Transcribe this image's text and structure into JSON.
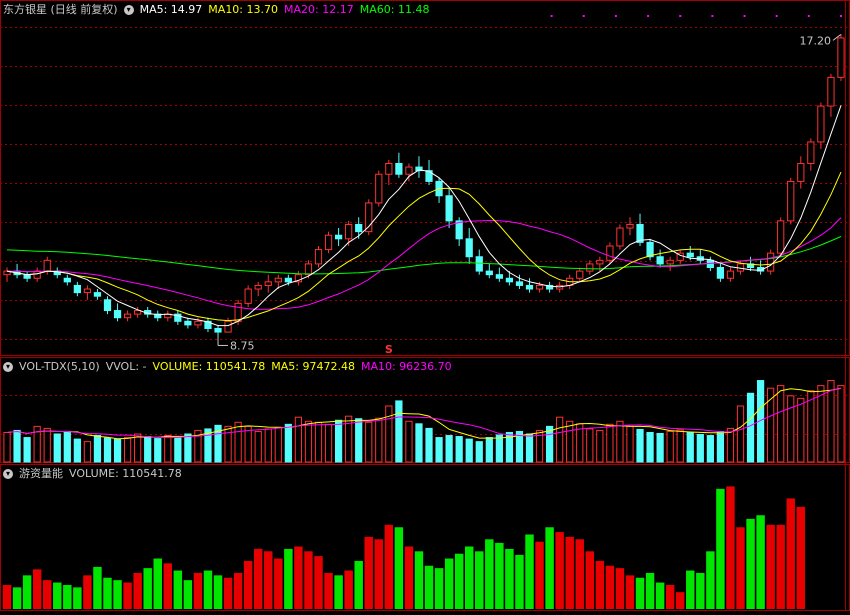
{
  "colors": {
    "up": "#ff3232",
    "down": "#54fcfc",
    "ma5": "#ffffff",
    "ma10": "#ffff00",
    "ma20": "#ff00ff",
    "ma60": "#00ff00",
    "grid": "#a00000",
    "green_bar": "#00e600",
    "red_bar": "#e60000",
    "label_grey": "#c8c8c8"
  },
  "price_panel": {
    "title": "东方银星 (日线 前复权)",
    "ma5_label": "MA5: 14.97",
    "ma10_label": "MA10: 13.70",
    "ma20_label": "MA20: 12.17",
    "ma60_label": "MA60: 11.48",
    "high_label": "17.20",
    "low_label": "8.75",
    "signal_label": "S"
  },
  "volume_panel": {
    "title": "VOL-TDX(5,10)",
    "vvol_label": "VVOL: -",
    "volume_label": "VOLUME: 110541.78",
    "ma5_label": "MA5: 97472.48",
    "ma10_label": "MA10: 96236.70"
  },
  "flow_panel": {
    "title": "游资量能",
    "volume_label": "VOLUME: 110541.78"
  },
  "chart_data": [
    {
      "type": "candlestick",
      "title": "东方银星 (日线 前复权)",
      "y_range": [
        8.4,
        17.6
      ],
      "annotations": {
        "high": 17.2,
        "low": 8.75
      },
      "series": [
        {
          "name": "MA5",
          "last": 14.97
        },
        {
          "name": "MA10",
          "last": 13.7
        },
        {
          "name": "MA20",
          "last": 12.17
        },
        {
          "name": "MA60",
          "last": 11.48
        }
      ],
      "ohlc": [
        [
          10.5,
          10.7,
          10.3,
          10.6
        ],
        [
          10.6,
          10.8,
          10.4,
          10.5
        ],
        [
          10.5,
          10.6,
          10.3,
          10.4
        ],
        [
          10.4,
          10.7,
          10.3,
          10.6
        ],
        [
          10.6,
          11.0,
          10.5,
          10.9
        ],
        [
          10.6,
          10.7,
          10.4,
          10.5
        ],
        [
          10.4,
          10.5,
          10.2,
          10.3
        ],
        [
          10.2,
          10.3,
          9.9,
          10.0
        ],
        [
          10.0,
          10.2,
          9.8,
          10.1
        ],
        [
          10.0,
          10.1,
          9.8,
          9.9
        ],
        [
          9.8,
          9.9,
          9.4,
          9.5
        ],
        [
          9.5,
          9.7,
          9.2,
          9.3
        ],
        [
          9.3,
          9.5,
          9.2,
          9.4
        ],
        [
          9.4,
          9.6,
          9.3,
          9.5
        ],
        [
          9.5,
          9.6,
          9.3,
          9.4
        ],
        [
          9.4,
          9.5,
          9.2,
          9.3
        ],
        [
          9.3,
          9.5,
          9.2,
          9.4
        ],
        [
          9.4,
          9.5,
          9.1,
          9.2
        ],
        [
          9.2,
          9.3,
          9.0,
          9.1
        ],
        [
          9.1,
          9.3,
          9.0,
          9.2
        ],
        [
          9.2,
          9.3,
          8.9,
          9.0
        ],
        [
          9.0,
          9.1,
          8.75,
          8.9
        ],
        [
          8.9,
          9.3,
          8.9,
          9.2
        ],
        [
          9.2,
          9.8,
          9.1,
          9.7
        ],
        [
          9.7,
          10.2,
          9.6,
          10.1
        ],
        [
          10.1,
          10.3,
          9.9,
          10.2
        ],
        [
          10.2,
          10.5,
          10.0,
          10.3
        ],
        [
          10.3,
          10.5,
          10.1,
          10.4
        ],
        [
          10.4,
          10.5,
          10.2,
          10.3
        ],
        [
          10.3,
          10.6,
          10.2,
          10.5
        ],
        [
          10.5,
          10.9,
          10.4,
          10.8
        ],
        [
          10.8,
          11.3,
          10.7,
          11.2
        ],
        [
          11.2,
          11.7,
          11.1,
          11.6
        ],
        [
          11.6,
          11.8,
          11.3,
          11.5
        ],
        [
          11.5,
          12.0,
          11.3,
          11.9
        ],
        [
          11.9,
          12.1,
          11.5,
          11.7
        ],
        [
          11.7,
          12.6,
          11.6,
          12.5
        ],
        [
          12.5,
          13.4,
          12.4,
          13.3
        ],
        [
          13.3,
          13.7,
          13.0,
          13.6
        ],
        [
          13.6,
          13.9,
          13.2,
          13.3
        ],
        [
          13.3,
          13.6,
          13.1,
          13.5
        ],
        [
          13.5,
          13.8,
          13.2,
          13.4
        ],
        [
          13.4,
          13.7,
          13.0,
          13.1
        ],
        [
          13.1,
          13.2,
          12.5,
          12.7
        ],
        [
          12.7,
          12.9,
          11.8,
          12.0
        ],
        [
          12.0,
          12.1,
          11.3,
          11.5
        ],
        [
          11.5,
          11.8,
          10.8,
          11.0
        ],
        [
          11.0,
          11.2,
          10.5,
          10.6
        ],
        [
          10.6,
          10.8,
          10.4,
          10.5
        ],
        [
          10.5,
          10.7,
          10.3,
          10.4
        ],
        [
          10.4,
          10.6,
          10.2,
          10.3
        ],
        [
          10.3,
          10.5,
          10.1,
          10.2
        ],
        [
          10.2,
          10.4,
          10.0,
          10.1
        ],
        [
          10.1,
          10.3,
          10.0,
          10.2
        ],
        [
          10.2,
          10.3,
          10.0,
          10.1
        ],
        [
          10.1,
          10.3,
          10.0,
          10.2
        ],
        [
          10.2,
          10.5,
          10.1,
          10.4
        ],
        [
          10.4,
          10.7,
          10.3,
          10.6
        ],
        [
          10.6,
          10.9,
          10.5,
          10.8
        ],
        [
          10.8,
          11.0,
          10.6,
          10.9
        ],
        [
          10.9,
          11.4,
          10.8,
          11.3
        ],
        [
          11.3,
          11.9,
          11.2,
          11.8
        ],
        [
          11.8,
          12.1,
          11.6,
          11.9
        ],
        [
          11.9,
          12.2,
          11.3,
          11.4
        ],
        [
          11.4,
          11.5,
          10.9,
          11.0
        ],
        [
          11.0,
          11.2,
          10.7,
          10.8
        ],
        [
          10.8,
          11.0,
          10.6,
          10.9
        ],
        [
          10.9,
          11.2,
          10.8,
          11.1
        ],
        [
          11.1,
          11.3,
          10.9,
          11.0
        ],
        [
          11.0,
          11.2,
          10.8,
          10.9
        ],
        [
          10.9,
          11.0,
          10.6,
          10.7
        ],
        [
          10.7,
          10.8,
          10.3,
          10.4
        ],
        [
          10.4,
          10.7,
          10.3,
          10.6
        ],
        [
          10.6,
          10.9,
          10.5,
          10.8
        ],
        [
          10.8,
          11.0,
          10.6,
          10.7
        ],
        [
          10.7,
          10.9,
          10.5,
          10.6
        ],
        [
          10.6,
          11.2,
          10.5,
          11.1
        ],
        [
          11.1,
          12.1,
          11.0,
          12.0
        ],
        [
          12.0,
          13.2,
          11.9,
          13.1
        ],
        [
          13.1,
          13.8,
          12.9,
          13.6
        ],
        [
          13.6,
          14.3,
          13.4,
          14.2
        ],
        [
          14.2,
          15.3,
          14.0,
          15.2
        ],
        [
          15.2,
          16.1,
          14.9,
          16.0
        ],
        [
          16.0,
          17.2,
          15.9,
          17.1
        ]
      ]
    },
    {
      "type": "bar",
      "title": "VOL-TDX(5,10)",
      "series": [
        {
          "name": "VOLUME",
          "last": 110541.78
        },
        {
          "name": "MA5",
          "last": 97472.48
        },
        {
          "name": "MA10",
          "last": 96236.7
        }
      ],
      "values": [
        58,
        62,
        48,
        70,
        66,
        55,
        60,
        45,
        40,
        52,
        47,
        45,
        48,
        55,
        50,
        46,
        52,
        48,
        55,
        62,
        65,
        72,
        70,
        78,
        70,
        60,
        65,
        68,
        74,
        88,
        80,
        78,
        74,
        82,
        90,
        85,
        78,
        86,
        110,
        120,
        80,
        75,
        66,
        48,
        52,
        50,
        45,
        40,
        48,
        53,
        58,
        60,
        55,
        62,
        70,
        88,
        80,
        75,
        65,
        62,
        74,
        80,
        70,
        64,
        58,
        56,
        60,
        63,
        58,
        54,
        52,
        60,
        66,
        110,
        135,
        160,
        145,
        150,
        130,
        125,
        140,
        150,
        160,
        110541.78
      ]
    },
    {
      "type": "bar",
      "title": "游资量能",
      "series": [
        {
          "name": "VOLUME",
          "last": 110541.78
        }
      ],
      "values": [
        20,
        18,
        28,
        33,
        24,
        22,
        20,
        18,
        28,
        35,
        26,
        24,
        22,
        30,
        34,
        42,
        38,
        32,
        24,
        30,
        32,
        28,
        26,
        30,
        40,
        50,
        48,
        42,
        50,
        52,
        48,
        44,
        30,
        28,
        32,
        40,
        60,
        58,
        70,
        68,
        52,
        48,
        36,
        34,
        42,
        46,
        52,
        48,
        58,
        55,
        50,
        45,
        62,
        56,
        68,
        64,
        60,
        58,
        48,
        40,
        36,
        34,
        28,
        26,
        30,
        22,
        20,
        14,
        32,
        30,
        48,
        100,
        102,
        68,
        75,
        78,
        70,
        70,
        92,
        85
      ]
    }
  ]
}
